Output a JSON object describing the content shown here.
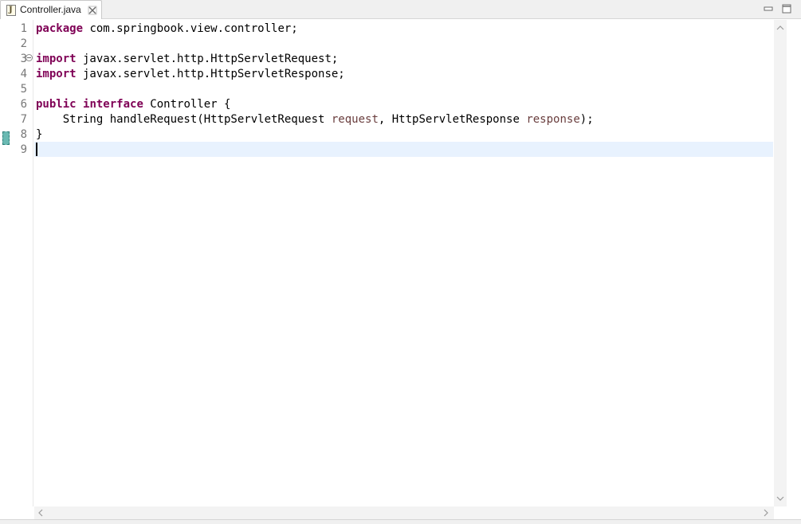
{
  "tab": {
    "icon": "java-file-icon",
    "icon_glyph": "J",
    "label": "Controller.java",
    "close_icon": "close-icon"
  },
  "window_controls": {
    "minimize_icon": "minimize-icon",
    "maximize_icon": "maximize-icon"
  },
  "editor": {
    "line_numbers": [
      "1",
      "2",
      "3",
      "4",
      "5",
      "6",
      "7",
      "8",
      "9"
    ],
    "current_line": "9",
    "lines": [
      {
        "n": "1",
        "tokens": [
          {
            "t": "kw",
            "v": "package"
          },
          {
            "t": "plain",
            "v": " com.springbook.view.controller;"
          }
        ]
      },
      {
        "n": "2",
        "tokens": []
      },
      {
        "n": "3",
        "tokens": [
          {
            "t": "kw",
            "v": "import"
          },
          {
            "t": "plain",
            "v": " javax.servlet.http.HttpServletRequest;"
          }
        ]
      },
      {
        "n": "4",
        "tokens": [
          {
            "t": "kw",
            "v": "import"
          },
          {
            "t": "plain",
            "v": " javax.servlet.http.HttpServletResponse;"
          }
        ]
      },
      {
        "n": "5",
        "tokens": []
      },
      {
        "n": "6",
        "tokens": [
          {
            "t": "kw",
            "v": "public"
          },
          {
            "t": "plain",
            "v": " "
          },
          {
            "t": "kw",
            "v": "interface"
          },
          {
            "t": "plain",
            "v": " Controller {"
          }
        ]
      },
      {
        "n": "7",
        "tokens": [
          {
            "t": "plain",
            "v": "    String handleRequest(HttpServletRequest "
          },
          {
            "t": "param",
            "v": "request"
          },
          {
            "t": "plain",
            "v": ", HttpServletResponse "
          },
          {
            "t": "param",
            "v": "response"
          },
          {
            "t": "plain",
            "v": ");"
          }
        ]
      },
      {
        "n": "8",
        "tokens": [
          {
            "t": "plain",
            "v": "}"
          }
        ]
      },
      {
        "n": "9",
        "tokens": []
      }
    ]
  },
  "colors": {
    "keyword": "#7f0055",
    "parameter": "#6a3e3e",
    "current_line_highlight": "#e8f2fe",
    "change_marker": "#6ab9b2"
  }
}
